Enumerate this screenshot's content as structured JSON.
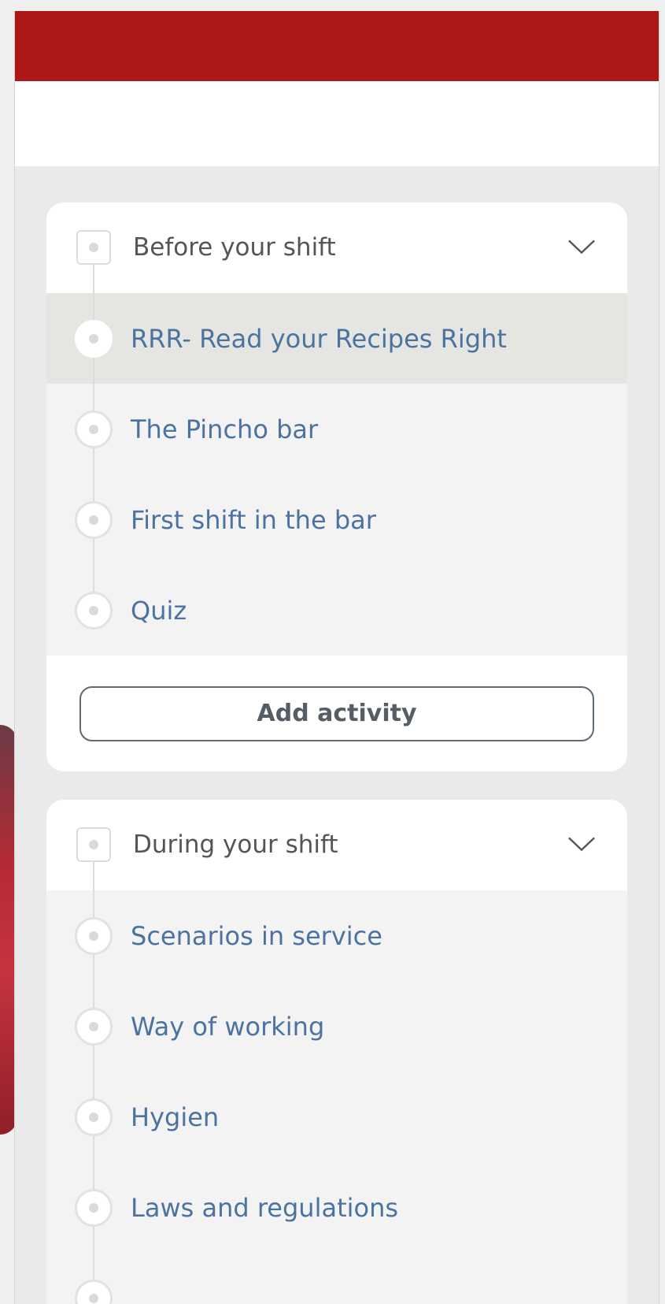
{
  "colors": {
    "header_red": "#ad1716",
    "link_blue": "#4c73a0",
    "active_row": "#e5e5e1"
  },
  "sections": [
    {
      "title": "Before your shift",
      "expand_icon": "chevron-down-icon",
      "items": [
        {
          "label": "RRR- Read your Recipes Right",
          "active": true
        },
        {
          "label": "The Pincho bar",
          "active": false
        },
        {
          "label": "First shift in the bar",
          "active": false
        },
        {
          "label": "Quiz",
          "active": false
        }
      ],
      "add_button_label": "Add activity"
    },
    {
      "title": "During your shift",
      "expand_icon": "chevron-down-icon",
      "items": [
        {
          "label": "Scenarios in service",
          "active": false
        },
        {
          "label": "Way of working",
          "active": false
        },
        {
          "label": "Hygien",
          "active": false
        },
        {
          "label": "Laws and regulations",
          "active": false
        }
      ]
    }
  ]
}
